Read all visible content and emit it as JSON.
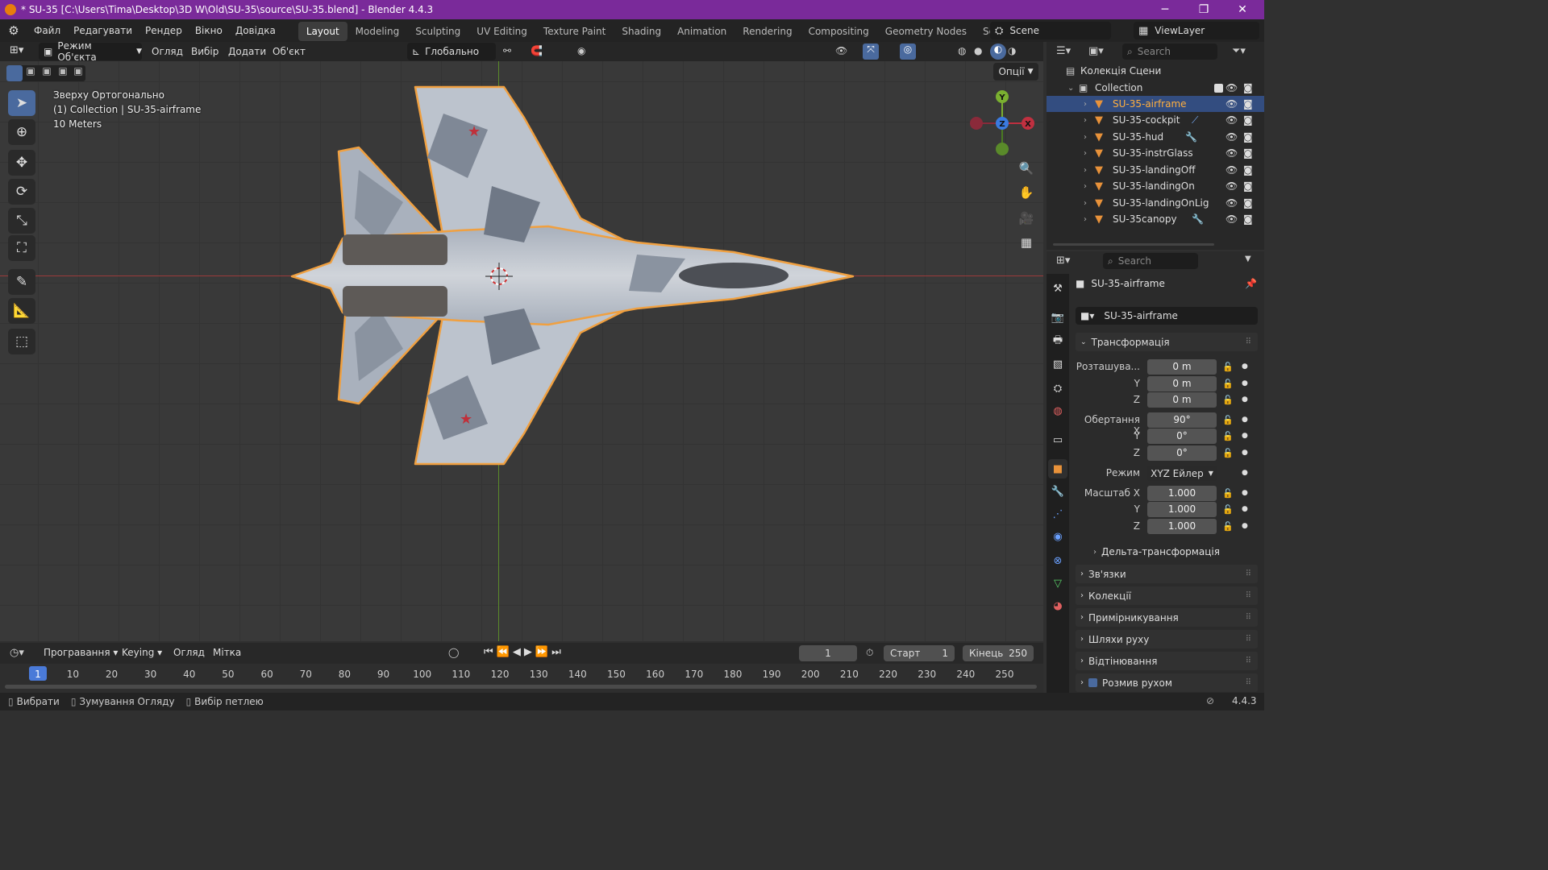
{
  "window": {
    "title": "* SU-35 [C:\\Users\\Tima\\Desktop\\3D W\\Old\\SU-35\\source\\SU-35.blend] - Blender 4.4.3",
    "minimize": "─",
    "maximize": "❐",
    "close": "✕"
  },
  "menu": [
    "Файл",
    "Редагувати",
    "Рендер",
    "Вікно",
    "Довідка"
  ],
  "workspaces": [
    {
      "label": "Layout",
      "active": true
    },
    {
      "label": "Modeling"
    },
    {
      "label": "Sculpting"
    },
    {
      "label": "UV Editing"
    },
    {
      "label": "Texture Paint"
    },
    {
      "label": "Shading"
    },
    {
      "label": "Animation"
    },
    {
      "label": "Rendering"
    },
    {
      "label": "Compositing"
    },
    {
      "label": "Geometry Nodes"
    },
    {
      "label": "Scripting"
    }
  ],
  "add_workspace": "+",
  "scene": {
    "label": "Scene",
    "view_layer": "ViewLayer"
  },
  "viewport_header": {
    "mode": "Режим Об'єкта",
    "view": "Огляд",
    "select": "Вибір",
    "add": "Додати",
    "object": "Об'єкт",
    "orientation": "Глобально",
    "options": "Опції"
  },
  "viewport_info": {
    "view_name": "Зверху Ортогонально",
    "collection_line": "(1) Collection | SU-35-airframe",
    "scale": "10 Meters"
  },
  "gizmo": {
    "y": "Y",
    "z": "Z",
    "x": "X"
  },
  "outliner": {
    "search_placeholder": "Search",
    "scene_collection": "Колекція Сцени",
    "collection": "Collection",
    "items": [
      {
        "name": "SU-35-airframe",
        "selected": true
      },
      {
        "name": "SU-35-cockpit"
      },
      {
        "name": "SU-35-hud"
      },
      {
        "name": "SU-35-instrGlass"
      },
      {
        "name": "SU-35-landingOff"
      },
      {
        "name": "SU-35-landingOn"
      },
      {
        "name": "SU-35-landingOnLig"
      },
      {
        "name": "SU-35canopy"
      }
    ]
  },
  "properties": {
    "search_placeholder": "Search",
    "object_name": "SU-35-airframe",
    "data_name": "SU-35-airframe",
    "transform_header": "Трансформація",
    "location_label": "Розташува...",
    "location": [
      "0 m",
      "0 m",
      "0 m"
    ],
    "rotation_label": "Обертання X",
    "rotation": [
      "90°",
      "0°",
      "0°"
    ],
    "mode_label": "Режим",
    "mode_value": "XYZ Ейлер",
    "scale_label": "Масштаб X",
    "scale": [
      "1.000",
      "1.000",
      "1.000"
    ],
    "axis_y": "Y",
    "axis_z": "Z",
    "delta_transform": "Дельта-трансформація",
    "sections": [
      "Зв'язки",
      "Колекції",
      "Примірникування",
      "Шляхи руху",
      "Відтінювання",
      "Розмив рухом"
    ]
  },
  "timeline": {
    "menu_play": "Програвання",
    "menu_keying": "Keying",
    "menu_view": "Огляд",
    "menu_marker": "Мітка",
    "current_frame": "1",
    "start_label": "Старт",
    "start": "1",
    "end_label": "Кінець",
    "end": "250",
    "ticks": [
      "1",
      "10",
      "20",
      "30",
      "40",
      "50",
      "60",
      "70",
      "80",
      "90",
      "100",
      "110",
      "120",
      "130",
      "140",
      "150",
      "160",
      "170",
      "180",
      "190",
      "200",
      "210",
      "220",
      "230",
      "240",
      "250"
    ]
  },
  "statusbar": {
    "select": "Вибрати",
    "zoom": "Зумування Огляду",
    "lasso": "Вибір петлею",
    "version": "4.4.3"
  },
  "colors": {
    "title_bar": "#7a2a9a",
    "selection": "#334d80",
    "outline": "#f0a040",
    "active_tool": "#4a6a9e"
  }
}
